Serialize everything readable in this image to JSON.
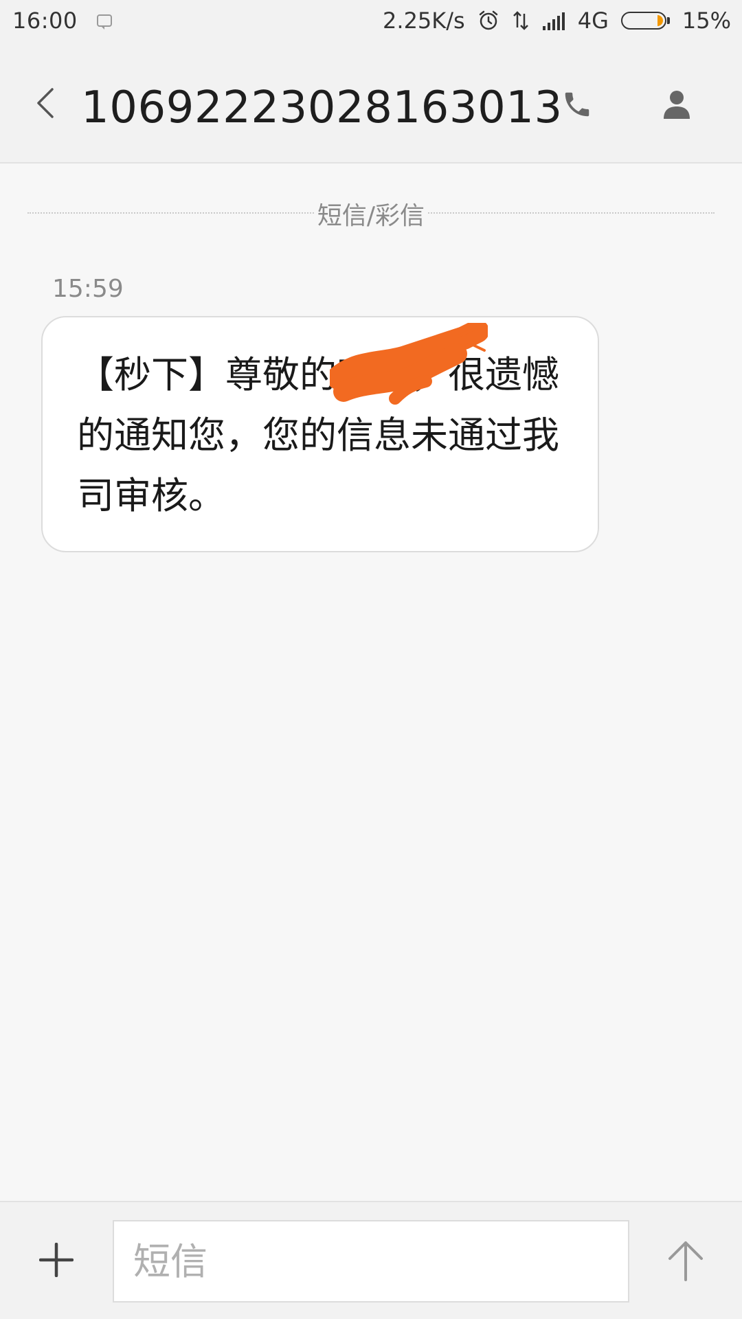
{
  "status_bar": {
    "time": "16:00",
    "network_speed": "2.25K/s",
    "network_type": "4G",
    "battery_percent_label": "15%",
    "battery_level": 0.15,
    "icons": [
      "sms-notification-icon",
      "alarm-icon",
      "data-transfer-icon",
      "signal-icon",
      "battery-icon"
    ]
  },
  "header": {
    "title": "10692223028163013",
    "icons": [
      "back-chevron-icon",
      "phone-icon",
      "person-icon"
    ]
  },
  "conversation": {
    "divider_label": "短信/彩信",
    "messages": [
      {
        "time": "15:59",
        "text": "【秒下】尊敬的客户，很遗憾的通知您，您的信息未通过我司审核。",
        "redaction_color": "#f26a21"
      }
    ]
  },
  "composer": {
    "placeholder": "短信",
    "value": "",
    "icons": [
      "plus-icon",
      "send-arrow-icon"
    ]
  },
  "colors": {
    "background": "#f7f7f7",
    "bar_background": "#f2f2f2",
    "bubble": "#ffffff",
    "battery_accent": "#f39800"
  }
}
